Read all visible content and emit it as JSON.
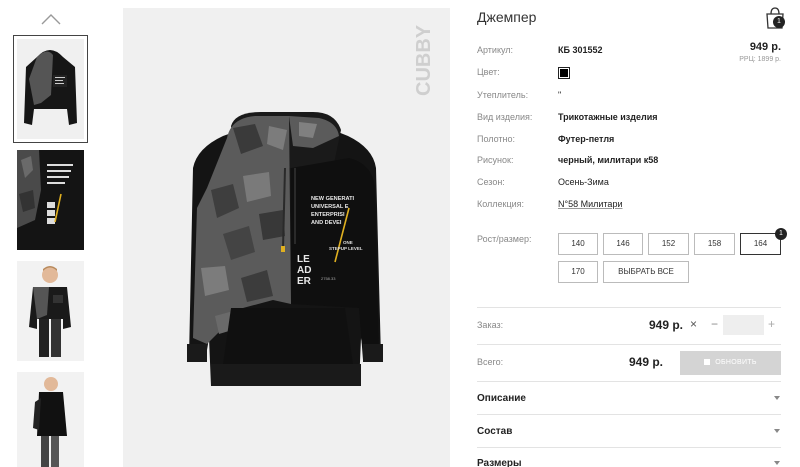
{
  "product": {
    "title": "Джемпер",
    "price": "949 р.",
    "rrp": "РРЦ: 1899 р.",
    "brand": "CUBBY"
  },
  "cart": {
    "count": "1",
    "icon": "shopping-bag-icon"
  },
  "attributes": [
    {
      "label": "Артикул:",
      "value": "КБ 301552"
    },
    {
      "label": "Цвет:",
      "value": "",
      "color": "#000000"
    },
    {
      "label": "Утеплитель:",
      "value": "\""
    },
    {
      "label": "Вид изделия:",
      "value": "Трикотажные изделия"
    },
    {
      "label": "Полотно:",
      "value": "Футер-петля"
    },
    {
      "label": "Рисунок:",
      "value": "черный, милитари к58"
    },
    {
      "label": "Сезон:",
      "value": "Осень-Зима"
    },
    {
      "label": "Коллекция:",
      "value": "N°58 Милитари"
    }
  ],
  "sizes": {
    "label": "Рост/размер:",
    "options": [
      "140",
      "146",
      "152",
      "158",
      "164",
      "170"
    ],
    "selected": "164",
    "selected_count": "1",
    "select_all": "ВЫБРАТЬ ВСЕ"
  },
  "order": {
    "label": "Заказ:",
    "price": "949 р.",
    "remove": "×",
    "minus": "−",
    "plus": "+",
    "quantity": ""
  },
  "total": {
    "label": "Всего:",
    "price": "949 р.",
    "update_button": "ОБНОВИТЬ"
  },
  "accordion": [
    "Описание",
    "Состав",
    "Размеры"
  ],
  "print_text": {
    "line1": "NEW GENERATI",
    "line2": "UNIVERSAL E",
    "line3": "ENTERPRISI",
    "line4": "AND DEVEI",
    "le": "LE",
    "ad": "AD",
    "er": "ER",
    "one": "ONE",
    "stepup": "STEPUP LEVEL",
    "small": "2758.33"
  }
}
